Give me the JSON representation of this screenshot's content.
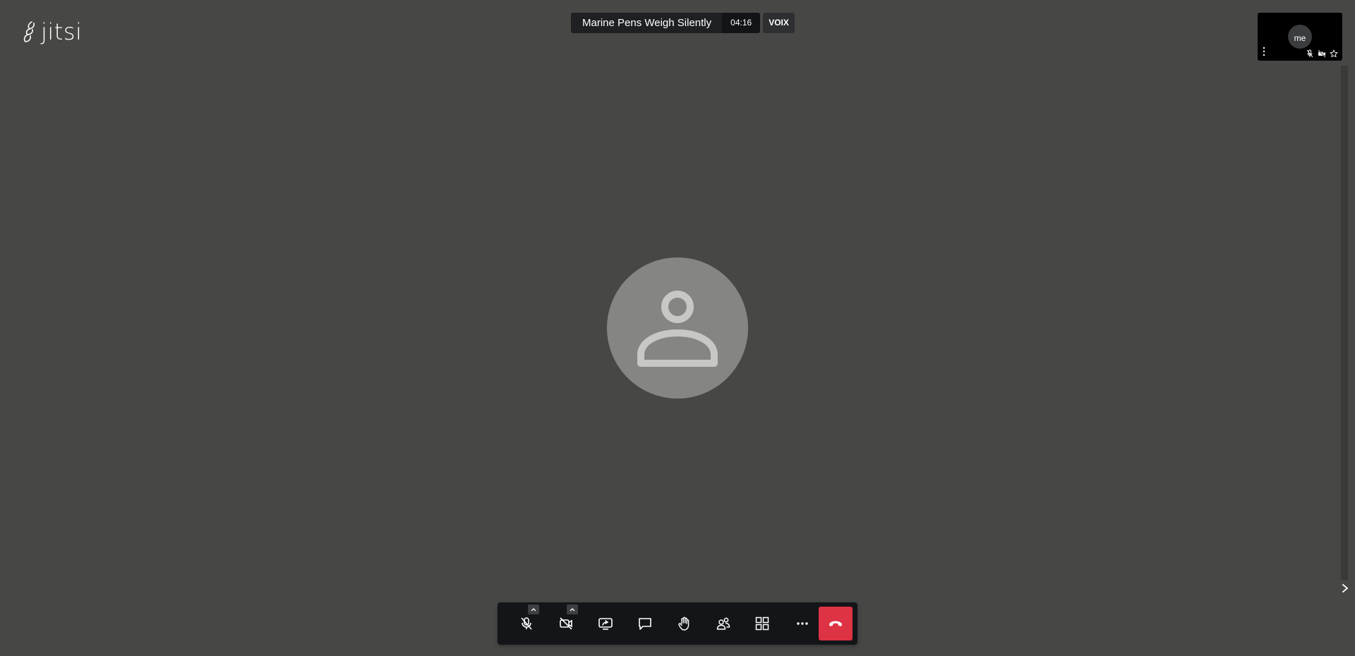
{
  "app": {
    "logo_text": "jitsi"
  },
  "meeting": {
    "title": "Marine Pens Weigh Silently",
    "timer": "04:16",
    "badge": "VOIX"
  },
  "self_view": {
    "name": "me",
    "icons": [
      "microphone-off-icon",
      "camera-off-icon",
      "star-icon"
    ]
  },
  "toolbar": {
    "buttons": [
      {
        "name": "microphone-button",
        "icon": "microphone-off-icon"
      },
      {
        "name": "camera-button",
        "icon": "camera-off-icon"
      },
      {
        "name": "share-screen-button",
        "icon": "screen-share-icon"
      },
      {
        "name": "chat-button",
        "icon": "chat-icon"
      },
      {
        "name": "raise-hand-button",
        "icon": "hand-icon"
      },
      {
        "name": "participants-button",
        "icon": "participants-icon"
      },
      {
        "name": "tile-view-button",
        "icon": "grid-icon"
      },
      {
        "name": "more-actions-button",
        "icon": "ellipsis-icon"
      },
      {
        "name": "hangup-button",
        "icon": "phone-hangup-icon"
      }
    ]
  },
  "colors": {
    "background": "#474846",
    "toolbar": "#131519",
    "hangup": "#dd3344",
    "avatar": "#858684"
  }
}
